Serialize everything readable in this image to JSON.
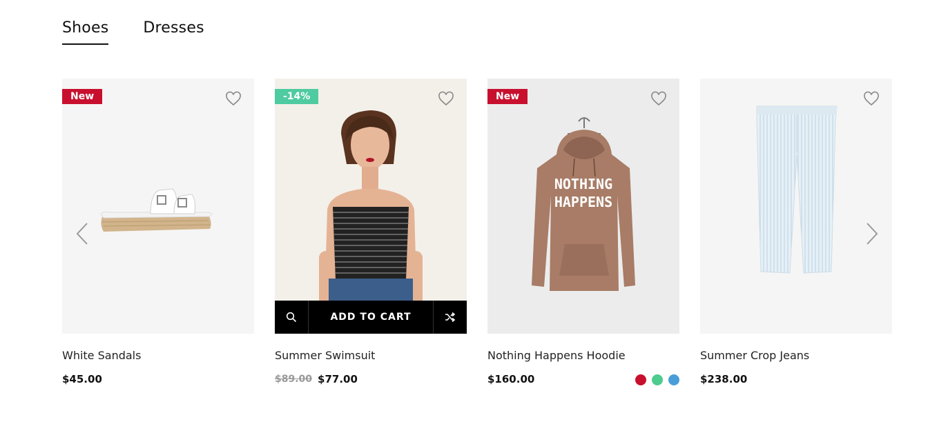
{
  "tabs": [
    {
      "label": "Shoes",
      "active": true
    },
    {
      "label": "Dresses",
      "active": false
    }
  ],
  "colors": {
    "badge_new": "#c8102e",
    "badge_sale": "#4ecba0",
    "text_dark": "#111111",
    "price_old": "#999999"
  },
  "products": [
    {
      "name": "White Sandals",
      "price": "$45.00",
      "badge": "New",
      "image_icon": "white-sandals-image"
    },
    {
      "name": "Summer Swimsuit",
      "price": "$77.00",
      "old_price": "$89.00",
      "badge": "-14%",
      "image_icon": "woman-striped-top-image",
      "add_to_cart": "ADD TO CART"
    },
    {
      "name": "Nothing Happens Hoodie",
      "price": "$160.00",
      "badge": "New",
      "image_icon": "brown-hoodie-image",
      "hoodie_print": [
        "NOTHING",
        "HAPPENS"
      ],
      "swatches": [
        "#c8102e",
        "#4ecb8f",
        "#4a9ed8"
      ]
    },
    {
      "name": "Summer Crop Jeans",
      "price": "$238.00",
      "image_icon": "light-striped-jeans-image"
    }
  ],
  "icons": {
    "wishlist": "heart-outline-icon",
    "prev": "chevron-left-icon",
    "next": "chevron-right-icon",
    "quick_view": "search-icon",
    "compare": "shuffle-icon"
  }
}
